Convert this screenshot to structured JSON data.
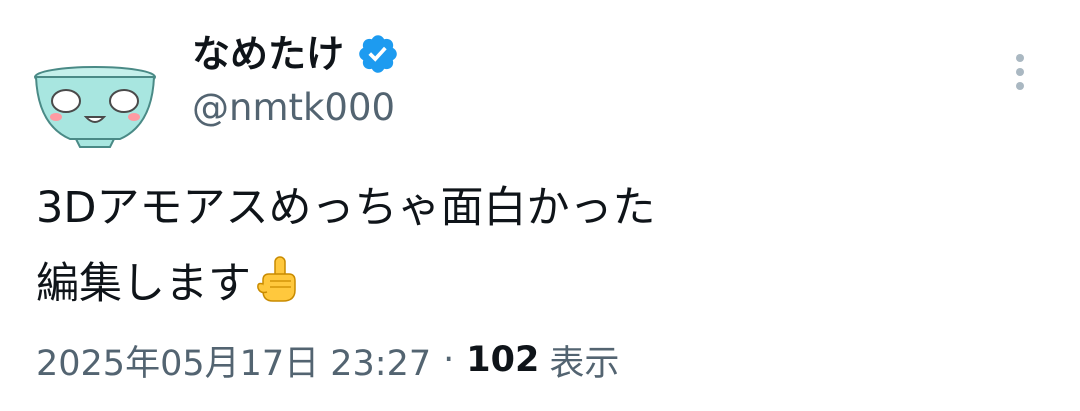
{
  "author": {
    "display_name": "なめたけ",
    "handle": "@nmtk000",
    "verified": true,
    "avatar_icon": "green-bowl-face-icon"
  },
  "tweet": {
    "lines": [
      "3Dアモアスめっちゃ面白かった",
      "編集します"
    ],
    "trailing_emoji": "pointing-up-hand-emoji"
  },
  "meta": {
    "timestamp": "2025年05月17日 23:27",
    "separator": "·",
    "views_count": "102",
    "views_label": "表示"
  },
  "colors": {
    "text_primary": "#0f1419",
    "text_secondary": "#536471",
    "verified_blue": "#1d9bf0",
    "avatar_bowl": "#a8e6e0"
  }
}
